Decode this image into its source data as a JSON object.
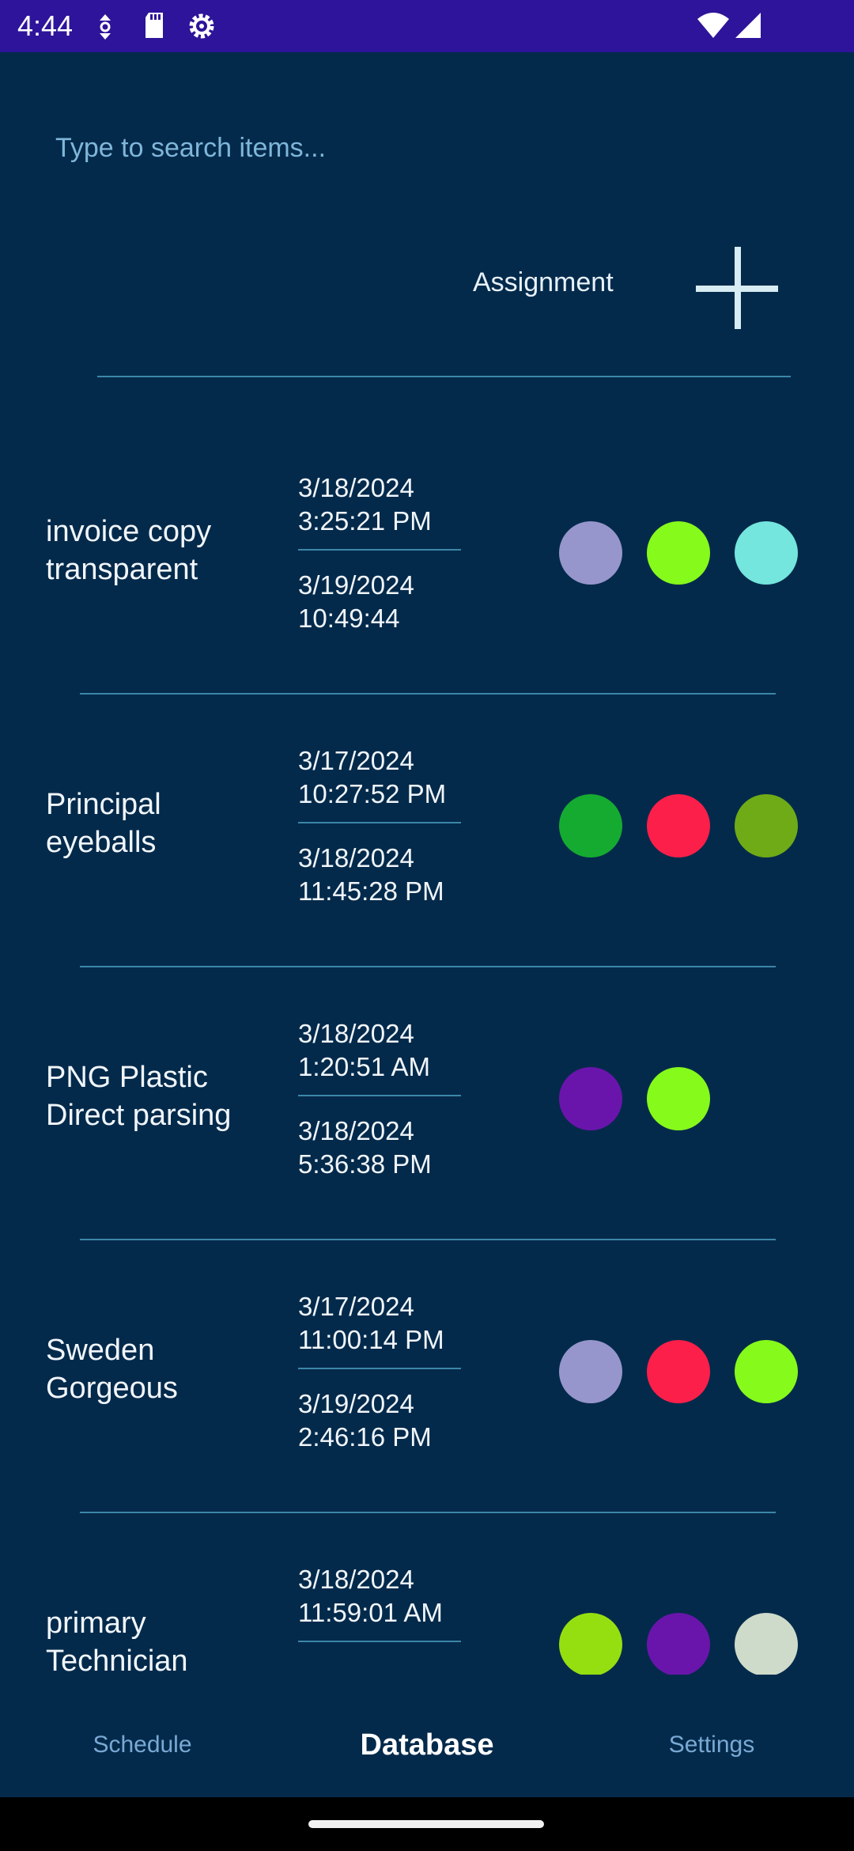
{
  "status_bar": {
    "time": "4:44",
    "icons": [
      "data-saver-icon",
      "sd-card-icon",
      "settings-gear-icon",
      "wifi-icon",
      "cell-signal-icon"
    ]
  },
  "search": {
    "placeholder": "Type to search items..."
  },
  "header": {
    "label": "Assignment",
    "add_icon": "plus-icon"
  },
  "items": [
    {
      "title_line1": "invoice copy",
      "title_line2": "transparent",
      "start_date": "3/18/2024",
      "start_time": "3:25:21 PM",
      "end_date": "3/19/2024",
      "end_time": "10:49:44",
      "tags": [
        "#9696cc",
        "#86fa1b",
        "#74e6dd"
      ]
    },
    {
      "title_line1": "Principal",
      "title_line2": "eyeballs",
      "start_date": "3/17/2024",
      "start_time": "10:27:52 PM",
      "end_date": "3/18/2024",
      "end_time": "11:45:28 PM",
      "tags": [
        "#15ab31",
        "#fb1f4a",
        "#6fab17"
      ]
    },
    {
      "title_line1": "PNG Plastic",
      "title_line2": "Direct parsing",
      "start_date": "3/18/2024",
      "start_time": "1:20:51 AM",
      "end_date": "3/18/2024",
      "end_time": "5:36:38 PM",
      "tags": [
        "#6915ab",
        "#86fa1b"
      ]
    },
    {
      "title_line1": "Sweden",
      "title_line2": "Gorgeous",
      "start_date": "3/17/2024",
      "start_time": "11:00:14 PM",
      "end_date": "3/19/2024",
      "end_time": "2:46:16 PM",
      "tags": [
        "#9696cc",
        "#fb1f4a",
        "#86fa1b"
      ]
    },
    {
      "title_line1": "primary",
      "title_line2": "Technician",
      "start_date": "3/18/2024",
      "start_time": "11:59:01 AM",
      "end_date": "",
      "end_time": "",
      "tags": [
        "#95df11",
        "#6915ab",
        "#cfdbca"
      ]
    }
  ],
  "nav": {
    "tabs": [
      {
        "label": "Schedule",
        "active": false
      },
      {
        "label": "Database",
        "active": true
      },
      {
        "label": "Settings",
        "active": false
      }
    ]
  },
  "colors": {
    "background": "#042a4b",
    "status_bar": "#2e149a",
    "divider": "#3c86a8",
    "placeholder": "#7fb6da"
  }
}
